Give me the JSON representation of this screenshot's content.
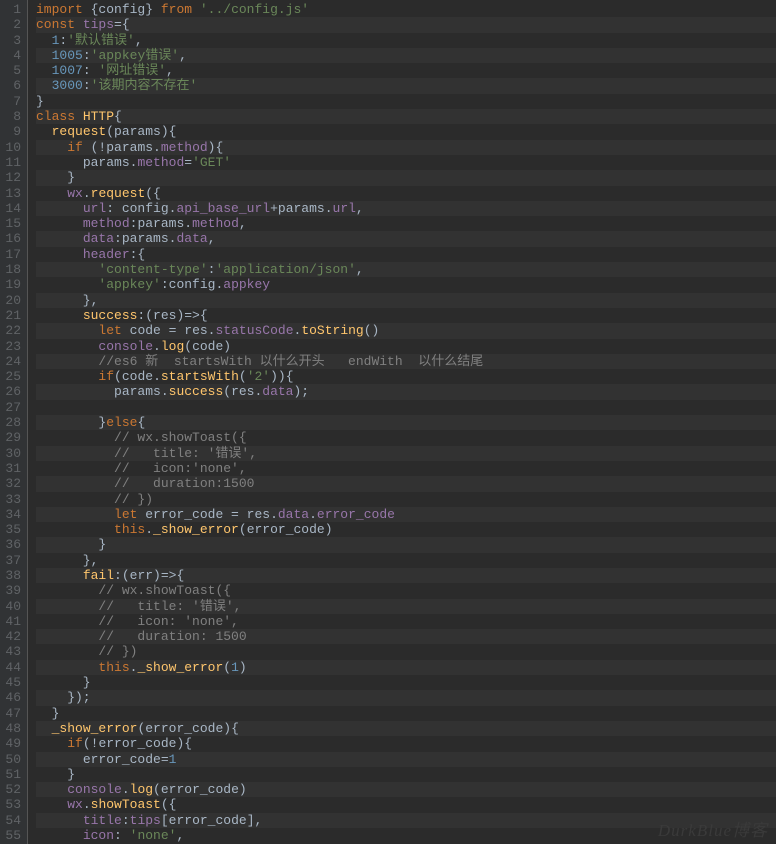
{
  "watermark": "DurkBlue博客",
  "lines": [
    {
      "n": 1,
      "stripe": false,
      "tokens": [
        [
          "kw",
          "import"
        ],
        [
          "op",
          " {"
        ],
        [
          "fn",
          "config"
        ],
        [
          "op",
          "} "
        ],
        [
          "kw",
          "from "
        ],
        [
          "str",
          "'../config.js'"
        ]
      ]
    },
    {
      "n": 2,
      "stripe": true,
      "tokens": [
        [
          "kw",
          "const "
        ],
        [
          "var",
          "tips"
        ],
        [
          "op",
          "={"
        ]
      ]
    },
    {
      "n": 3,
      "stripe": false,
      "tokens": [
        [
          "op",
          "  "
        ],
        [
          "num",
          "1"
        ],
        [
          "op",
          ":"
        ],
        [
          "str",
          "'默认错误'"
        ],
        [
          "op",
          ","
        ]
      ]
    },
    {
      "n": 4,
      "stripe": true,
      "tokens": [
        [
          "op",
          "  "
        ],
        [
          "num",
          "1005"
        ],
        [
          "op",
          ":"
        ],
        [
          "str",
          "'appkey错误'"
        ],
        [
          "op",
          ","
        ]
      ]
    },
    {
      "n": 5,
      "stripe": false,
      "tokens": [
        [
          "op",
          "  "
        ],
        [
          "num",
          "1007"
        ],
        [
          "op",
          ": "
        ],
        [
          "str",
          "'网址错误'"
        ],
        [
          "op",
          ","
        ]
      ]
    },
    {
      "n": 6,
      "stripe": true,
      "tokens": [
        [
          "op",
          "  "
        ],
        [
          "num",
          "3000"
        ],
        [
          "op",
          ":"
        ],
        [
          "str",
          "'该期内容不存在'"
        ]
      ]
    },
    {
      "n": 7,
      "stripe": false,
      "tokens": [
        [
          "op",
          "}"
        ]
      ]
    },
    {
      "n": 8,
      "stripe": true,
      "tokens": [
        [
          "kw",
          "class "
        ],
        [
          "id",
          "HTTP"
        ],
        [
          "op",
          "{"
        ]
      ]
    },
    {
      "n": 9,
      "stripe": false,
      "tokens": [
        [
          "op",
          "  "
        ],
        [
          "id",
          "request"
        ],
        [
          "op",
          "("
        ],
        [
          "fn",
          "params"
        ],
        [
          "op",
          "){"
        ]
      ]
    },
    {
      "n": 10,
      "stripe": true,
      "tokens": [
        [
          "op",
          "    "
        ],
        [
          "kw",
          "if "
        ],
        [
          "op",
          "(!"
        ],
        [
          "fn",
          "params"
        ],
        [
          "op",
          "."
        ],
        [
          "var",
          "method"
        ],
        [
          "op",
          "){"
        ]
      ]
    },
    {
      "n": 11,
      "stripe": false,
      "tokens": [
        [
          "op",
          "      "
        ],
        [
          "fn",
          "params"
        ],
        [
          "op",
          "."
        ],
        [
          "var",
          "method"
        ],
        [
          "op",
          "="
        ],
        [
          "str",
          "'GET'"
        ]
      ]
    },
    {
      "n": 12,
      "stripe": true,
      "tokens": [
        [
          "op",
          "    }"
        ]
      ]
    },
    {
      "n": 13,
      "stripe": false,
      "tokens": [
        [
          "op",
          "    "
        ],
        [
          "var",
          "wx"
        ],
        [
          "op",
          "."
        ],
        [
          "id",
          "request"
        ],
        [
          "op",
          "({"
        ]
      ]
    },
    {
      "n": 14,
      "stripe": true,
      "tokens": [
        [
          "op",
          "      "
        ],
        [
          "var",
          "url"
        ],
        [
          "op",
          ": "
        ],
        [
          "fn",
          "config"
        ],
        [
          "op",
          "."
        ],
        [
          "var",
          "api_base_url"
        ],
        [
          "op",
          "+"
        ],
        [
          "fn",
          "params"
        ],
        [
          "op",
          "."
        ],
        [
          "var",
          "url"
        ],
        [
          "op",
          ","
        ]
      ]
    },
    {
      "n": 15,
      "stripe": false,
      "tokens": [
        [
          "op",
          "      "
        ],
        [
          "var",
          "method"
        ],
        [
          "op",
          ":"
        ],
        [
          "fn",
          "params"
        ],
        [
          "op",
          "."
        ],
        [
          "var",
          "method"
        ],
        [
          "op",
          ","
        ]
      ]
    },
    {
      "n": 16,
      "stripe": true,
      "tokens": [
        [
          "op",
          "      "
        ],
        [
          "var",
          "data"
        ],
        [
          "op",
          ":"
        ],
        [
          "fn",
          "params"
        ],
        [
          "op",
          "."
        ],
        [
          "var",
          "data"
        ],
        [
          "op",
          ","
        ]
      ]
    },
    {
      "n": 17,
      "stripe": false,
      "tokens": [
        [
          "op",
          "      "
        ],
        [
          "var",
          "header"
        ],
        [
          "op",
          ":{"
        ]
      ]
    },
    {
      "n": 18,
      "stripe": true,
      "tokens": [
        [
          "op",
          "        "
        ],
        [
          "str",
          "'content-type'"
        ],
        [
          "op",
          ":"
        ],
        [
          "str",
          "'application/json'"
        ],
        [
          "op",
          ","
        ]
      ]
    },
    {
      "n": 19,
      "stripe": false,
      "tokens": [
        [
          "op",
          "        "
        ],
        [
          "str",
          "'appkey'"
        ],
        [
          "op",
          ":"
        ],
        [
          "fn",
          "config"
        ],
        [
          "op",
          "."
        ],
        [
          "var",
          "appkey"
        ]
      ]
    },
    {
      "n": 20,
      "stripe": true,
      "tokens": [
        [
          "op",
          "      },"
        ]
      ]
    },
    {
      "n": 21,
      "stripe": false,
      "tokens": [
        [
          "op",
          "      "
        ],
        [
          "id",
          "success"
        ],
        [
          "op",
          ":("
        ],
        [
          "fn",
          "res"
        ],
        [
          "op",
          ")=>{"
        ]
      ]
    },
    {
      "n": 22,
      "stripe": true,
      "tokens": [
        [
          "op",
          "        "
        ],
        [
          "kw",
          "let "
        ],
        [
          "fn",
          "code"
        ],
        [
          "op",
          " = "
        ],
        [
          "fn",
          "res"
        ],
        [
          "op",
          "."
        ],
        [
          "var",
          "statusCode"
        ],
        [
          "op",
          "."
        ],
        [
          "id",
          "toString"
        ],
        [
          "op",
          "()"
        ]
      ]
    },
    {
      "n": 23,
      "stripe": false,
      "tokens": [
        [
          "op",
          "        "
        ],
        [
          "var",
          "console"
        ],
        [
          "op",
          "."
        ],
        [
          "id",
          "log"
        ],
        [
          "op",
          "("
        ],
        [
          "fn",
          "code"
        ],
        [
          "op",
          ")"
        ]
      ]
    },
    {
      "n": 24,
      "stripe": true,
      "tokens": [
        [
          "op",
          "        "
        ],
        [
          "cmt",
          "//es6 新  startsWith 以什么开头   endWith  以什么结尾"
        ]
      ]
    },
    {
      "n": 25,
      "stripe": false,
      "tokens": [
        [
          "op",
          "        "
        ],
        [
          "kw",
          "if"
        ],
        [
          "op",
          "("
        ],
        [
          "fn",
          "code"
        ],
        [
          "op",
          "."
        ],
        [
          "id",
          "startsWith"
        ],
        [
          "op",
          "("
        ],
        [
          "str",
          "'2'"
        ],
        [
          "op",
          ")){"
        ]
      ]
    },
    {
      "n": 26,
      "stripe": true,
      "tokens": [
        [
          "op",
          "          "
        ],
        [
          "fn",
          "params"
        ],
        [
          "op",
          "."
        ],
        [
          "id",
          "success"
        ],
        [
          "op",
          "("
        ],
        [
          "fn",
          "res"
        ],
        [
          "op",
          "."
        ],
        [
          "var",
          "data"
        ],
        [
          "op",
          ");"
        ]
      ]
    },
    {
      "n": 27,
      "stripe": false,
      "tokens": [
        [
          "op",
          ""
        ]
      ]
    },
    {
      "n": 28,
      "stripe": true,
      "tokens": [
        [
          "op",
          "        }"
        ],
        [
          "kw",
          "else"
        ],
        [
          "op",
          "{"
        ]
      ]
    },
    {
      "n": 29,
      "stripe": false,
      "tokens": [
        [
          "op",
          "          "
        ],
        [
          "cmt",
          "// wx.showToast({"
        ]
      ]
    },
    {
      "n": 30,
      "stripe": true,
      "tokens": [
        [
          "op",
          "          "
        ],
        [
          "cmt",
          "//   title: '错误',"
        ]
      ]
    },
    {
      "n": 31,
      "stripe": false,
      "tokens": [
        [
          "op",
          "          "
        ],
        [
          "cmt",
          "//   icon:'none',"
        ]
      ]
    },
    {
      "n": 32,
      "stripe": true,
      "tokens": [
        [
          "op",
          "          "
        ],
        [
          "cmt",
          "//   duration:1500"
        ]
      ]
    },
    {
      "n": 33,
      "stripe": false,
      "tokens": [
        [
          "op",
          "          "
        ],
        [
          "cmt",
          "// })"
        ]
      ]
    },
    {
      "n": 34,
      "stripe": true,
      "tokens": [
        [
          "op",
          "          "
        ],
        [
          "kw",
          "let "
        ],
        [
          "fn",
          "error_code"
        ],
        [
          "op",
          " = "
        ],
        [
          "fn",
          "res"
        ],
        [
          "op",
          "."
        ],
        [
          "var",
          "data"
        ],
        [
          "op",
          "."
        ],
        [
          "var",
          "error_code"
        ]
      ]
    },
    {
      "n": 35,
      "stripe": false,
      "tokens": [
        [
          "op",
          "          "
        ],
        [
          "this",
          "this"
        ],
        [
          "op",
          "."
        ],
        [
          "id",
          "_show_error"
        ],
        [
          "op",
          "("
        ],
        [
          "fn",
          "error_code"
        ],
        [
          "op",
          ")"
        ]
      ]
    },
    {
      "n": 36,
      "stripe": true,
      "tokens": [
        [
          "op",
          "        }"
        ]
      ]
    },
    {
      "n": 37,
      "stripe": false,
      "tokens": [
        [
          "op",
          "      },"
        ]
      ]
    },
    {
      "n": 38,
      "stripe": true,
      "tokens": [
        [
          "op",
          "      "
        ],
        [
          "id",
          "fail"
        ],
        [
          "op",
          ":("
        ],
        [
          "fn",
          "err"
        ],
        [
          "op",
          ")=>{"
        ]
      ]
    },
    {
      "n": 39,
      "stripe": false,
      "tokens": [
        [
          "op",
          "        "
        ],
        [
          "cmt",
          "// wx.showToast({"
        ]
      ]
    },
    {
      "n": 40,
      "stripe": true,
      "tokens": [
        [
          "op",
          "        "
        ],
        [
          "cmt",
          "//   title: '错误',"
        ]
      ]
    },
    {
      "n": 41,
      "stripe": false,
      "tokens": [
        [
          "op",
          "        "
        ],
        [
          "cmt",
          "//   icon: 'none',"
        ]
      ]
    },
    {
      "n": 42,
      "stripe": true,
      "tokens": [
        [
          "op",
          "        "
        ],
        [
          "cmt",
          "//   duration: 1500"
        ]
      ]
    },
    {
      "n": 43,
      "stripe": false,
      "tokens": [
        [
          "op",
          "        "
        ],
        [
          "cmt",
          "// })"
        ]
      ]
    },
    {
      "n": 44,
      "stripe": true,
      "tokens": [
        [
          "op",
          "        "
        ],
        [
          "this",
          "this"
        ],
        [
          "op",
          "."
        ],
        [
          "id",
          "_show_error"
        ],
        [
          "op",
          "("
        ],
        [
          "num",
          "1"
        ],
        [
          "op",
          ")"
        ]
      ]
    },
    {
      "n": 45,
      "stripe": false,
      "tokens": [
        [
          "op",
          "      }"
        ]
      ]
    },
    {
      "n": 46,
      "stripe": true,
      "tokens": [
        [
          "op",
          "    });"
        ]
      ]
    },
    {
      "n": 47,
      "stripe": false,
      "tokens": [
        [
          "op",
          "  }"
        ]
      ]
    },
    {
      "n": 48,
      "stripe": true,
      "tokens": [
        [
          "op",
          "  "
        ],
        [
          "id",
          "_show_error"
        ],
        [
          "op",
          "("
        ],
        [
          "fn",
          "error_code"
        ],
        [
          "op",
          "){"
        ]
      ]
    },
    {
      "n": 49,
      "stripe": false,
      "tokens": [
        [
          "op",
          "    "
        ],
        [
          "kw",
          "if"
        ],
        [
          "op",
          "(!"
        ],
        [
          "fn",
          "error_code"
        ],
        [
          "op",
          "){"
        ]
      ]
    },
    {
      "n": 50,
      "stripe": true,
      "tokens": [
        [
          "op",
          "      "
        ],
        [
          "fn",
          "error_code"
        ],
        [
          "op",
          "="
        ],
        [
          "num",
          "1"
        ]
      ]
    },
    {
      "n": 51,
      "stripe": false,
      "tokens": [
        [
          "op",
          "    }"
        ]
      ]
    },
    {
      "n": 52,
      "stripe": true,
      "tokens": [
        [
          "op",
          "    "
        ],
        [
          "var",
          "console"
        ],
        [
          "op",
          "."
        ],
        [
          "id",
          "log"
        ],
        [
          "op",
          "("
        ],
        [
          "fn",
          "error_code"
        ],
        [
          "op",
          ")"
        ]
      ]
    },
    {
      "n": 53,
      "stripe": false,
      "tokens": [
        [
          "op",
          "    "
        ],
        [
          "var",
          "wx"
        ],
        [
          "op",
          "."
        ],
        [
          "id",
          "showToast"
        ],
        [
          "op",
          "({"
        ]
      ]
    },
    {
      "n": 54,
      "stripe": true,
      "tokens": [
        [
          "op",
          "      "
        ],
        [
          "var",
          "title"
        ],
        [
          "op",
          ":"
        ],
        [
          "var",
          "tips"
        ],
        [
          "op",
          "["
        ],
        [
          "fn",
          "error_code"
        ],
        [
          "op",
          "],"
        ]
      ]
    },
    {
      "n": 55,
      "stripe": false,
      "tokens": [
        [
          "op",
          "      "
        ],
        [
          "var",
          "icon"
        ],
        [
          "op",
          ": "
        ],
        [
          "str",
          "'none'"
        ],
        [
          "op",
          ","
        ]
      ]
    }
  ]
}
